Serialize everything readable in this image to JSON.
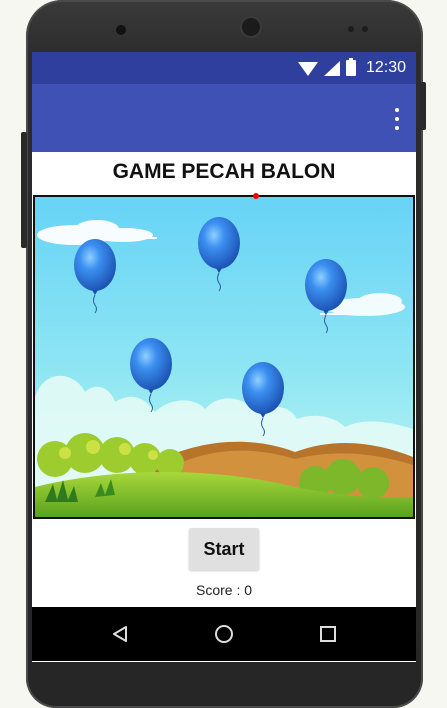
{
  "status_bar": {
    "time": "12:30",
    "icons": [
      "wifi-icon",
      "signal-icon",
      "battery-icon"
    ]
  },
  "app_bar": {
    "menu_icon": "overflow-menu-icon",
    "color": "#3f51b5",
    "status_color": "#2f3f9e"
  },
  "game": {
    "title": "GAME PECAH BALON",
    "balloon_count": 5,
    "balloon_color": "#2f7fe0",
    "sky_top": "#6ad4f5",
    "sky_bottom": "#b8f5ef"
  },
  "controls": {
    "start_label": "Start",
    "score_label": "Score : 0"
  },
  "nav": {
    "back_icon": "back-triangle-icon",
    "home_icon": "home-circle-icon",
    "recent_icon": "recent-square-icon"
  }
}
